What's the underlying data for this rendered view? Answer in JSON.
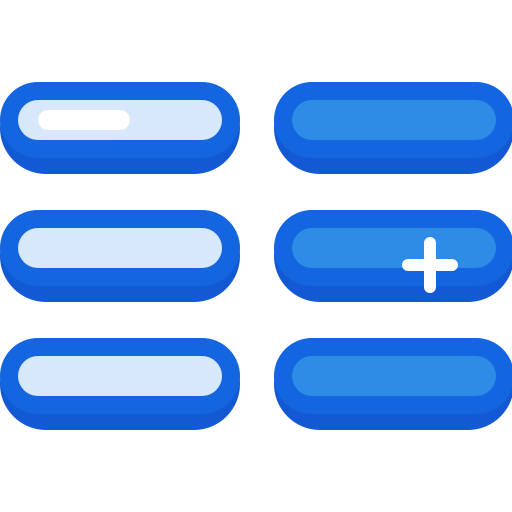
{
  "colors": {
    "outline": "#1366e0",
    "outline_shadow": "#1459d4",
    "light_fill": "#d7e7fc",
    "blue_fill": "#2e8be6",
    "highlight": "#ffffff",
    "plus": "#ffffff"
  },
  "icons": {
    "add": "plus-icon"
  },
  "pills": [
    {
      "id": "r1c1",
      "fill": "light",
      "highlighted": true
    },
    {
      "id": "r1c2",
      "fill": "blue"
    },
    {
      "id": "r2c1",
      "fill": "light"
    },
    {
      "id": "r2c2",
      "fill": "blue",
      "has_plus": true
    },
    {
      "id": "r3c1",
      "fill": "light"
    },
    {
      "id": "r3c2",
      "fill": "blue"
    }
  ]
}
